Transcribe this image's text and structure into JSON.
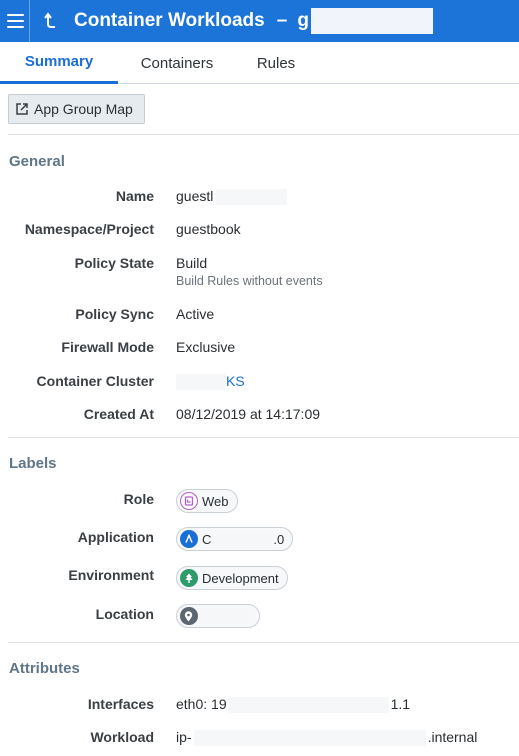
{
  "header": {
    "title": "Container Workloads",
    "separator": "–",
    "name_prefix": "g"
  },
  "tabs": [
    {
      "label": "Summary",
      "active": true
    },
    {
      "label": "Containers",
      "active": false
    },
    {
      "label": "Rules",
      "active": false
    }
  ],
  "toolbar": {
    "app_group_map_label": "App Group Map"
  },
  "general": {
    "title": "General",
    "name_label": "Name",
    "name_value": "guestl",
    "namespace_label": "Namespace/Project",
    "namespace_value": "guestbook",
    "policy_state_label": "Policy State",
    "policy_state_value": "Build",
    "policy_state_sub": "Build Rules without events",
    "policy_sync_label": "Policy Sync",
    "policy_sync_value": "Active",
    "firewall_mode_label": "Firewall Mode",
    "firewall_mode_value": "Exclusive",
    "container_cluster_label": "Container Cluster",
    "container_cluster_value": "KS",
    "created_at_label": "Created At",
    "created_at_value": "08/12/2019 at 14:17:09"
  },
  "labels": {
    "title": "Labels",
    "role_label": "Role",
    "role_value": "Web",
    "application_label": "Application",
    "application_value_start": "C",
    "application_value_end": ".0",
    "environment_label": "Environment",
    "environment_value": "Development",
    "location_label": "Location",
    "location_value": ""
  },
  "attributes": {
    "title": "Attributes",
    "interfaces_label": "Interfaces",
    "interfaces_value_start": "eth0: 19",
    "interfaces_value_end": "1.1",
    "workload_label": "Workload",
    "workload_value_start": "ip-",
    "workload_value_end": ".internal"
  },
  "colors": {
    "brand": "#1c73d8",
    "section_title": "#5e7688",
    "role_icon": "#b05fd0",
    "application_icon": "#1a6fd6",
    "environment_icon": "#2f9a6a",
    "location_icon": "#5c6670"
  },
  "icons": {
    "menu": "hamburger-icon",
    "back": "back-arrow-icon",
    "app_group_map": "external-link-icon",
    "role": "role-icon",
    "application": "application-icon",
    "environment": "tree-icon",
    "location": "location-pin-icon"
  }
}
